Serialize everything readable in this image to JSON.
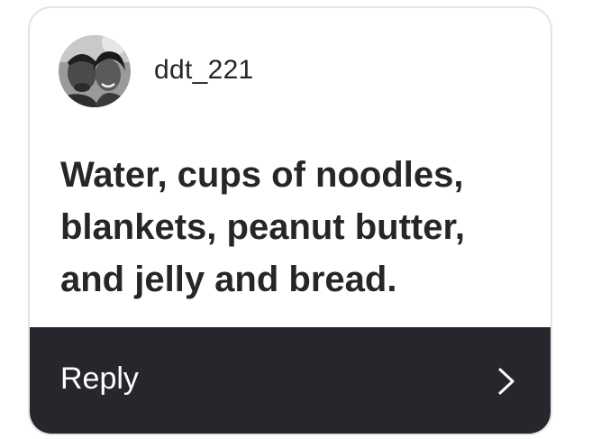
{
  "comment": {
    "username": "ddt_221",
    "avatar_icon": "profile-photo",
    "text": "Water, cups of noodles, blankets, peanut butter, and jelly and bread."
  },
  "reply": {
    "label": "Reply",
    "icon": "chevron-right-icon"
  },
  "colors": {
    "text": "#262626",
    "reply_bar": "#25272c",
    "reply_text": "#ffffff",
    "card_border": "#e4e4e4"
  }
}
